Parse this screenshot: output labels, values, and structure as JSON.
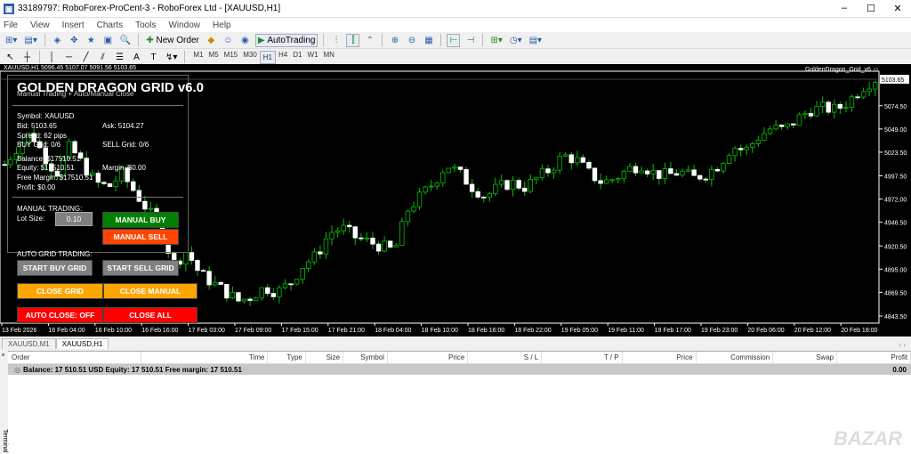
{
  "window": {
    "title": "33189797: RoboForex-ProCent-3 - RoboForex Ltd - [XAUUSD,H1]"
  },
  "menu": [
    "File",
    "View",
    "Insert",
    "Charts",
    "Tools",
    "Window",
    "Help"
  ],
  "toolbar": {
    "new_order": "New Order",
    "autotrading": "AutoTrading"
  },
  "timeframes": [
    "M1",
    "M5",
    "M15",
    "M30",
    "H1",
    "H4",
    "D1",
    "W1",
    "MN"
  ],
  "active_timeframe": "H1",
  "chart": {
    "header": "XAUUSD,H1  5096.45 5107.07 5091.56 5103.65",
    "indicator": "GoldenDragon_Grid_v6 ☺",
    "current_price": "5103.65",
    "price_labels": [
      "5074.50",
      "5049.00",
      "5023.50",
      "4997.50",
      "4972.00",
      "4946.50",
      "4920.50",
      "4895.00",
      "4869.50",
      "4843.50"
    ],
    "time_labels": [
      "13 Feb 2026",
      "16 Feb 04:00",
      "16 Feb 10:00",
      "16 Feb 16:00",
      "17 Feb 03:00",
      "17 Feb 09:00",
      "17 Feb 15:00",
      "17 Feb 21:00",
      "18 Feb 04:00",
      "18 Feb 10:00",
      "18 Feb 16:00",
      "18 Feb 22:00",
      "19 Feb 05:00",
      "19 Feb 11:00",
      "19 Feb 17:00",
      "19 Feb 23:00",
      "20 Feb 06:00",
      "20 Feb 12:00",
      "20 Feb 18:00"
    ],
    "approx_closes": [
      5010,
      5030,
      5045,
      5020,
      5000,
      5030,
      5010,
      4990,
      4985,
      5000,
      4980,
      4960,
      4940,
      4900,
      4915,
      4890,
      4880,
      4870,
      4860,
      4865,
      4875,
      4870,
      4880,
      4900,
      4910,
      4935,
      4940,
      4930,
      4925,
      4920,
      4915,
      4960,
      4975,
      4990,
      5010,
      5000,
      4985,
      4975,
      4985,
      4990,
      4985,
      4995,
      5005,
      5020,
      5015,
      5000,
      4990,
      4995,
      5005,
      5010,
      5000,
      4998,
      5002,
      4995,
      5000,
      5010,
      5030,
      5025,
      5040,
      5050,
      5048,
      5060,
      5070,
      5072,
      5070,
      5080,
      5095,
      5103.65
    ]
  },
  "panel": {
    "title": "GOLDEN DRAGON GRID v6.0",
    "subtitle": "Manual Trading + Auto/Manual Close",
    "symbol": "Symbol: XAUUSD",
    "bid": "Bid: 5103.65",
    "ask": "Ask: 5104.27",
    "spread": "Spread: 62 pips",
    "buy_grid": "BUY Grid: 0/6",
    "sell_grid": "SELL Grid: 0/6",
    "balance": "Balance: $17510.51",
    "equity": "Equity: $17510.51",
    "margin": "Margin: $0.00",
    "free_margin": "Free Margin: $17510.51",
    "profit": "Profit: $0.00",
    "manual_label": "MANUAL TRADING:",
    "lot_label": "Lot Size:",
    "lot_value": "0.10",
    "manual_buy": "MANUAL BUY",
    "manual_sell": "MANUAL SELL",
    "auto_label": "AUTO GRID TRADING:",
    "start_buy": "START BUY GRID",
    "start_sell": "START SELL GRID",
    "close_grid": "CLOSE GRID",
    "close_manual": "CLOSE MANUAL",
    "auto_close": "AUTO CLOSE: OFF",
    "close_all": "CLOSE ALL",
    "colors": {
      "buy": "#008000",
      "sell": "#ff4500",
      "gray": "#808080",
      "orange": "#ffa500",
      "red": "#ff0000"
    }
  },
  "chart_tabs": [
    "XAUUSD,M1",
    "XAUUSD,H1"
  ],
  "terminal": {
    "columns": [
      "Order",
      "Time",
      "Type",
      "Size",
      "Symbol",
      "Price",
      "S / L",
      "T / P",
      "Price",
      "Commission",
      "Swap",
      "Profit"
    ],
    "balance_row": "Balance: 17 510.51 USD  Equity: 17 510.51  Free margin: 17 510.51",
    "profit": "0.00",
    "side_label": "Terminal"
  }
}
